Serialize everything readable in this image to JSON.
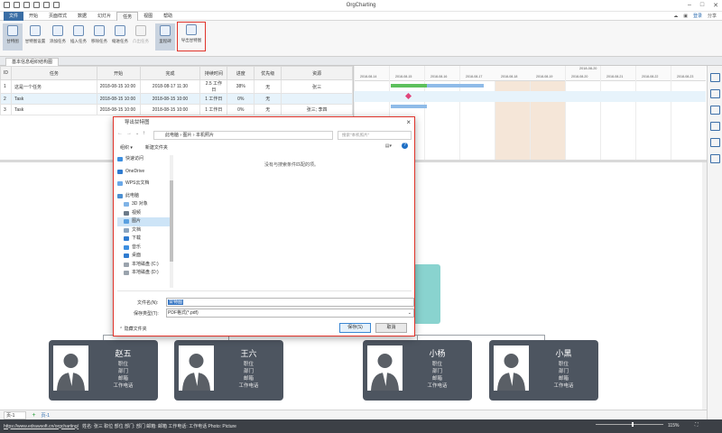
{
  "app": {
    "title": "OrgCharting"
  },
  "menu": {
    "file": "文件",
    "items": [
      "开始",
      "页面样式",
      "数据",
      "幻灯片",
      "任务",
      "视图",
      "帮助"
    ],
    "active": "任务"
  },
  "user": {
    "login": "登录",
    "share": "分享"
  },
  "ribbon": {
    "buttons": [
      "甘特图",
      "甘特图设置",
      "添加任务",
      "插入任务",
      "移除任务",
      "缩进任务",
      "凸出任务",
      "里程碑"
    ],
    "export": "导出甘特图"
  },
  "doc_tab": "基本信息组织结构图",
  "task_table": {
    "headers": [
      "ID",
      "任务",
      "开始",
      "完成",
      "持续时间",
      "进度",
      "优先级",
      "资源"
    ],
    "rows": [
      [
        "1",
        "这是一个任务",
        "2018-08-15 10:00",
        "2018-08-17 11:30",
        "2.5 工作日",
        "38%",
        "无",
        "张三"
      ],
      [
        "2",
        "Task",
        "2018-08-15 10:00",
        "2018-08-15 10:00",
        "1 工作日",
        "0%",
        "无",
        ""
      ],
      [
        "3",
        "Task",
        "2018-08-15 10:00",
        "2018-08-15 10:00",
        "1 工作日",
        "0%",
        "无",
        "张三; 李四"
      ]
    ]
  },
  "gantt": {
    "week_label": "2018-08-20",
    "dates": [
      "2018-08-14",
      "2018-08-15",
      "2018-08-16",
      "2018-08-17",
      "2018-08-18",
      "2018-08-19",
      "2018-08-20",
      "2018-08-21",
      "2018-08-22",
      "2018-08-23"
    ],
    "colors": {
      "progress": "#5cc05c",
      "bar": "#8fbbe8",
      "milestone": "#e0457b",
      "weekend": "#f5e6d8"
    }
  },
  "dialog": {
    "title": "导出甘特图",
    "path": [
      "此电脑",
      "图片",
      "本机照片"
    ],
    "search_placeholder": "搜索\"本机照片\"",
    "organize": "组织 ▾",
    "new_folder": "新建文件夹",
    "nav": [
      "快速访问",
      "OneDrive",
      "WPS云文档",
      "此电脑",
      "3D 对象",
      "视频",
      "图片",
      "文档",
      "下载",
      "音乐",
      "桌面",
      "本地磁盘 (C:)",
      "本地磁盘 (D:)"
    ],
    "nav_selected": "图片",
    "empty_message": "没有与搜索条件匹配的项。",
    "filename_label": "文件名(N):",
    "filename_value": "甘特图",
    "filetype_label": "保存类型(T):",
    "filetype_value": "PDF格式(*.pdf)",
    "hide_folders": "隐藏文件夹",
    "save": "保存(S)",
    "cancel": "取消"
  },
  "org_cards": [
    {
      "name": "赵五",
      "lines": [
        "职位",
        "部门",
        "邮箱",
        "工作电话"
      ]
    },
    {
      "name": "王六",
      "lines": [
        "职位",
        "部门",
        "邮箱",
        "工作电话"
      ]
    },
    {
      "name": "小杨",
      "lines": [
        "职位",
        "部门",
        "邮箱",
        "工作电话"
      ]
    },
    {
      "name": "小黑",
      "lines": [
        "职位",
        "部门",
        "邮箱",
        "工作电话"
      ]
    }
  ],
  "sheet": {
    "page": "页-1",
    "page_tab": "页-1"
  },
  "status": {
    "url": "https://www.edrawsoft.cn/orgcharting/",
    "fields": "姓名: 张三  职位  部位  部门: 部门  邮箱: 邮箱  工作电话: 工作电话  Photo: Picture",
    "zoom": "115%"
  }
}
